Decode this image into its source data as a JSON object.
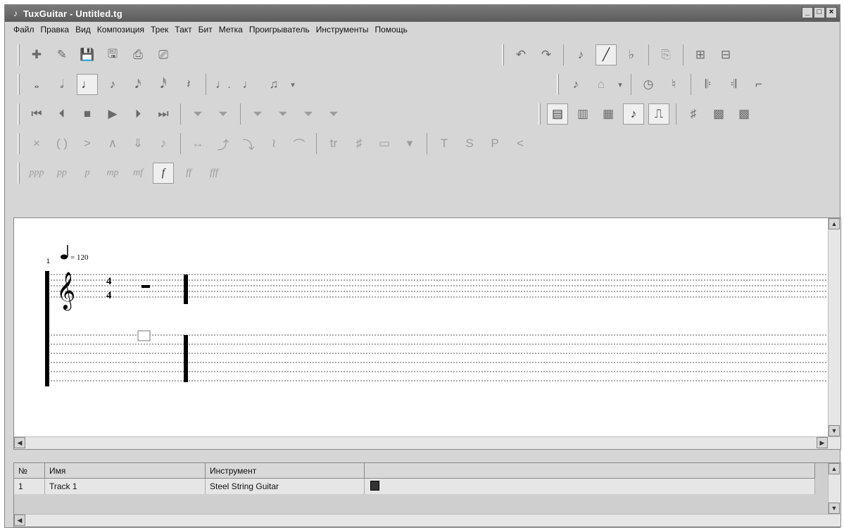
{
  "window": {
    "title": "TuxGuitar - Untitled.tg",
    "app_icon": "tuxguitar-icon",
    "buttons": [
      "_",
      "□",
      "×"
    ]
  },
  "menu": {
    "items": [
      "Файл",
      "Правка",
      "Вид",
      "Композиция",
      "Трек",
      "Такт",
      "Бит",
      "Метка",
      "Проигрыватель",
      "Инструменты",
      "Помощь"
    ]
  },
  "toolbar": {
    "file_glyphs": [
      "✚",
      "✎",
      "💾",
      "🖫",
      "⎙",
      "⎚"
    ],
    "edit_glyphs": [
      "↶",
      "↷",
      "♪",
      "╱",
      "♭",
      "⎘",
      "⊞",
      "⊟"
    ],
    "duration_glyphs": [
      "𝅝",
      "𝅗𝅥",
      "♩",
      "♪",
      "𝅘𝅥𝅯",
      "𝅘𝅥𝅰",
      "𝄽",
      "♩.",
      "♩",
      "♫",
      "▾"
    ],
    "duration_right_glyphs": [
      "♪",
      "⌂",
      "▾",
      "◷",
      "♮",
      "𝄆",
      "𝄇",
      "⌐"
    ],
    "transport_glyphs": [
      "⏮",
      "⏴",
      "■",
      "▶",
      "⏵",
      "⏭"
    ],
    "track_glyphs": [
      "⏷",
      "⏷",
      "⏷",
      "⏷",
      "⏷",
      "⏷"
    ],
    "view_glyphs": [
      "▤",
      "▥",
      "▦",
      "♪",
      "⎍",
      "♯",
      "▩",
      "▩"
    ],
    "effect_glyphs": [
      "×",
      "( )",
      ">",
      "∧",
      "⇓",
      "♪",
      "↔",
      "⤴",
      "⤵",
      "≀",
      "⌒",
      "tr",
      "♯",
      "▭",
      "▾",
      "T",
      "S",
      "P",
      "<"
    ],
    "dynamics_glyphs": [
      "ppp",
      "pp",
      "p",
      "mp",
      "mf",
      "f",
      "ff",
      "fff"
    ]
  },
  "score": {
    "tempo_label": "= 120",
    "measure_number": "1",
    "time_sig_top": "4",
    "time_sig_bottom": "4"
  },
  "tracks_table": {
    "headers": [
      "№",
      "Имя",
      "Инструмент"
    ],
    "rows": [
      {
        "number": "1",
        "name": "Track 1",
        "instrument": "Steel String Guitar"
      }
    ]
  }
}
